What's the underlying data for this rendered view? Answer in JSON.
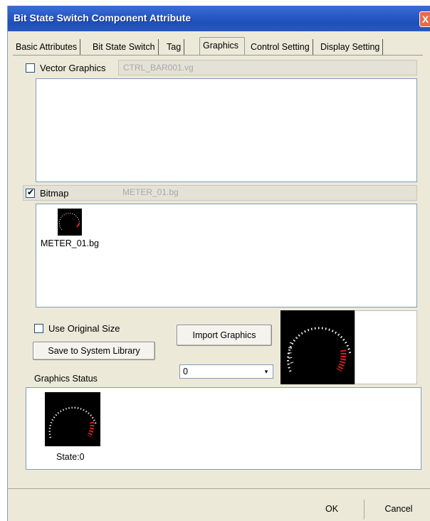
{
  "window": {
    "title": "Bit State Switch Component Attribute",
    "close_glyph": "X"
  },
  "tabs": [
    {
      "label": "Basic Attributes",
      "active": false
    },
    {
      "label": "Bit State Switch",
      "active": false
    },
    {
      "label": "Tag",
      "active": false
    },
    {
      "label": "Graphics",
      "active": true
    },
    {
      "label": "Control Setting",
      "active": false
    },
    {
      "label": "Display Setting",
      "active": false
    }
  ],
  "vector": {
    "label": "Vector Graphics",
    "checked": false,
    "path": "CTRL_BAR001.vg"
  },
  "bitmap": {
    "label": "Bitmap",
    "checked": true,
    "path": "METER_01.bg",
    "thumbnail_caption": "METER_01.bg"
  },
  "options": {
    "use_original_size": "Use Original Size",
    "save_to_library": "Save to System Library",
    "import_graphics": "Import Graphics"
  },
  "status": {
    "label": "Graphics Status",
    "selected_state": "0",
    "state_caption": "State:0"
  },
  "buttons": {
    "ok": "OK",
    "cancel": "Cancel"
  },
  "icons": [
    "meter-gauge-icon",
    "dropdown-arrow-icon",
    "close-icon"
  ]
}
